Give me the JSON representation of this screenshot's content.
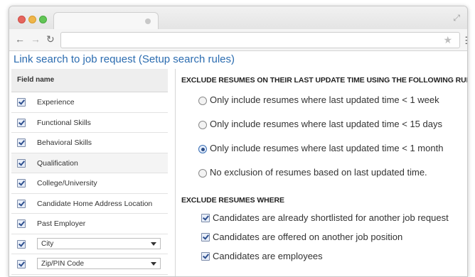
{
  "page": {
    "title": "Link search to job request (Setup search rules)"
  },
  "left_panel": {
    "header": "Field name",
    "rows": [
      {
        "label": "Experience",
        "checked": true
      },
      {
        "label": "Functional Skills",
        "checked": true
      },
      {
        "label": "Behavioral Skills",
        "checked": true
      },
      {
        "label": "Qualification",
        "checked": true
      },
      {
        "label": "College/University",
        "checked": true
      },
      {
        "label": "Candidate Home Address Location",
        "checked": true
      },
      {
        "label": "Past Employer",
        "checked": true
      }
    ],
    "select_rows": [
      {
        "value": "City",
        "checked": true
      },
      {
        "value": "Zip/PIN Code",
        "checked": true
      }
    ]
  },
  "right_panel": {
    "section1_title": "EXCLUDE RESUMES ON THEIR LAST UPDATE TIME USING THE FOLLOWING RULES",
    "radio_options": [
      {
        "label": "Only include resumes where last updated time < 1 week",
        "selected": false
      },
      {
        "label": "Only include resumes where last updated time < 15 days",
        "selected": false
      },
      {
        "label": "Only include resumes where last updated time < 1 month",
        "selected": true
      },
      {
        "label": "No exclusion of resumes based on last updated time.",
        "selected": false
      }
    ],
    "section2_title": "EXCLUDE RESUMES WHERE",
    "check_options": [
      {
        "label": "Candidates are already shortlisted for another job request",
        "checked": true
      },
      {
        "label": "Candidates are offered on another job position",
        "checked": true
      },
      {
        "label": "Candidates are employees",
        "checked": true
      }
    ]
  },
  "browser": {
    "address_value": "",
    "icons": [
      "back-arrow-icon",
      "forward-arrow-icon",
      "reload-icon",
      "bookmark-star-icon",
      "menu-icon",
      "fullscreen-icon"
    ]
  },
  "colors": {
    "title_blue": "#2b6cb0",
    "checkbox_blue": "#2d4f8f"
  }
}
